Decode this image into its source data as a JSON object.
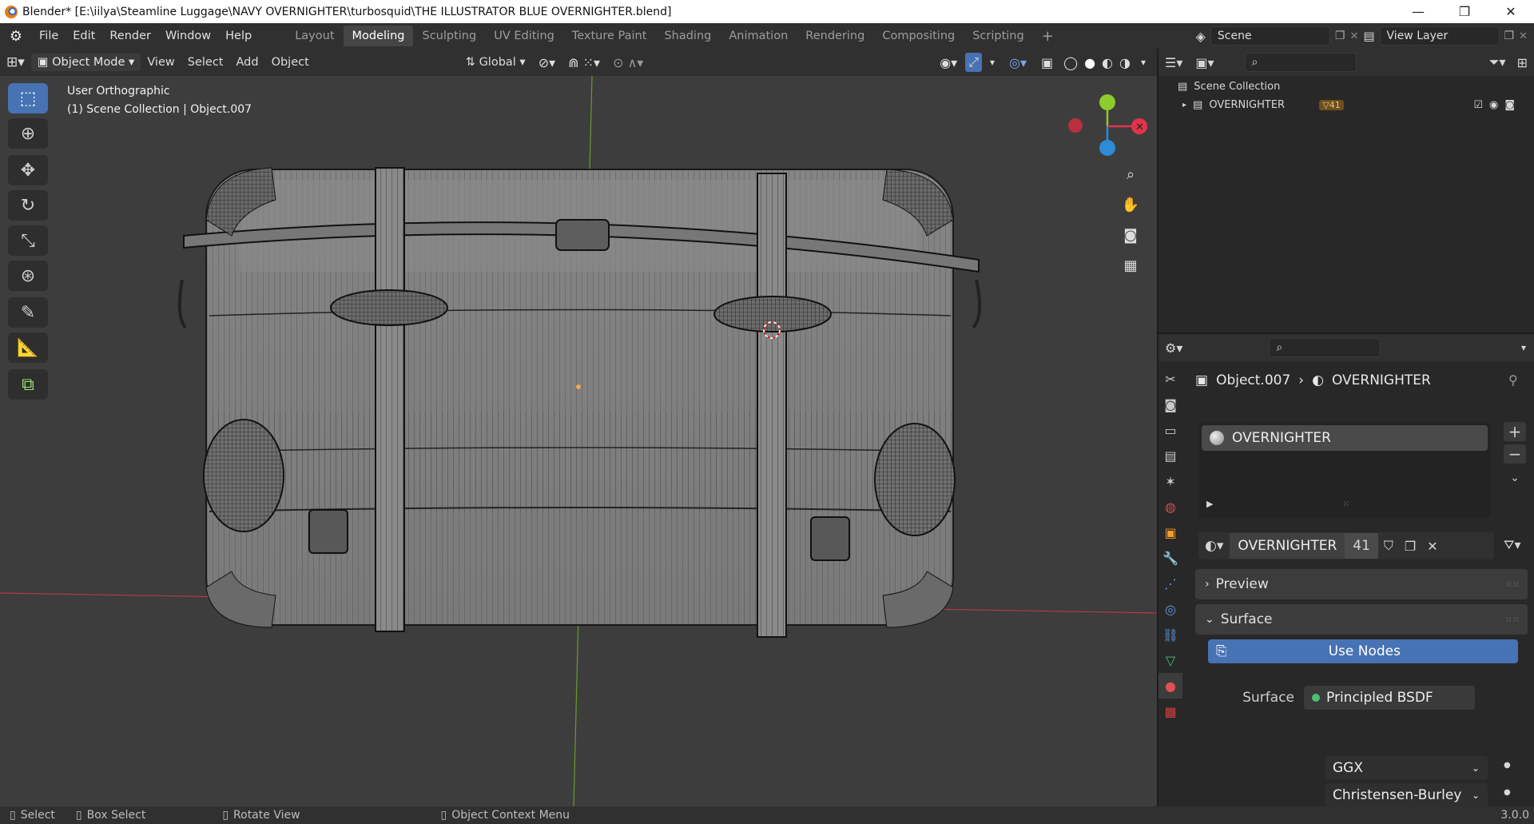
{
  "window": {
    "title": "Blender* [E:\\iilya\\Steamline Luggage\\NAVY OVERNIGHTER\\turbosquid\\THE ILLUSTRATOR BLUE OVERNIGHTER.blend]",
    "minimize": "—",
    "restore": "❐",
    "close": "✕"
  },
  "menu": {
    "items": [
      "File",
      "Edit",
      "Render",
      "Window",
      "Help"
    ]
  },
  "workspaces": [
    "Layout",
    "Modeling",
    "Sculpting",
    "UV Editing",
    "Texture Paint",
    "Shading",
    "Animation",
    "Rendering",
    "Compositing",
    "Scripting"
  ],
  "workspace_add": "+",
  "scene": {
    "name": "Scene",
    "view_layer": "View Layer"
  },
  "viewport_header": {
    "mode": "Object Mode",
    "view": "View",
    "select": "Select",
    "add": "Add",
    "object": "Object",
    "orientation": "Global"
  },
  "viewport": {
    "view_name": "User Orthographic",
    "context": "(1) Scene Collection | Object.007"
  },
  "outliner": {
    "root": "Scene Collection",
    "collection": "OVERNIGHTER",
    "badge": "41"
  },
  "properties": {
    "object": "Object.007",
    "material": "OVERNIGHTER",
    "slot": "OVERNIGHTER",
    "mat_name": "OVERNIGHTER",
    "users": "41",
    "preview": "Preview",
    "surface_panel": "Surface",
    "use_nodes": "Use Nodes",
    "surface_label": "Surface",
    "shader": "Principled BSDF",
    "distribution": "GGX",
    "subsurface": "Christensen-Burley"
  },
  "status": {
    "select": "Select",
    "box": "Box Select",
    "rotate": "Rotate View",
    "context": "Object Context Menu",
    "version": "3.0.0"
  },
  "colors": {
    "accent": "#4772b3",
    "x_axis": "#e0344a",
    "y_axis": "#8ecb2d",
    "z_axis": "#2e8bd7"
  }
}
